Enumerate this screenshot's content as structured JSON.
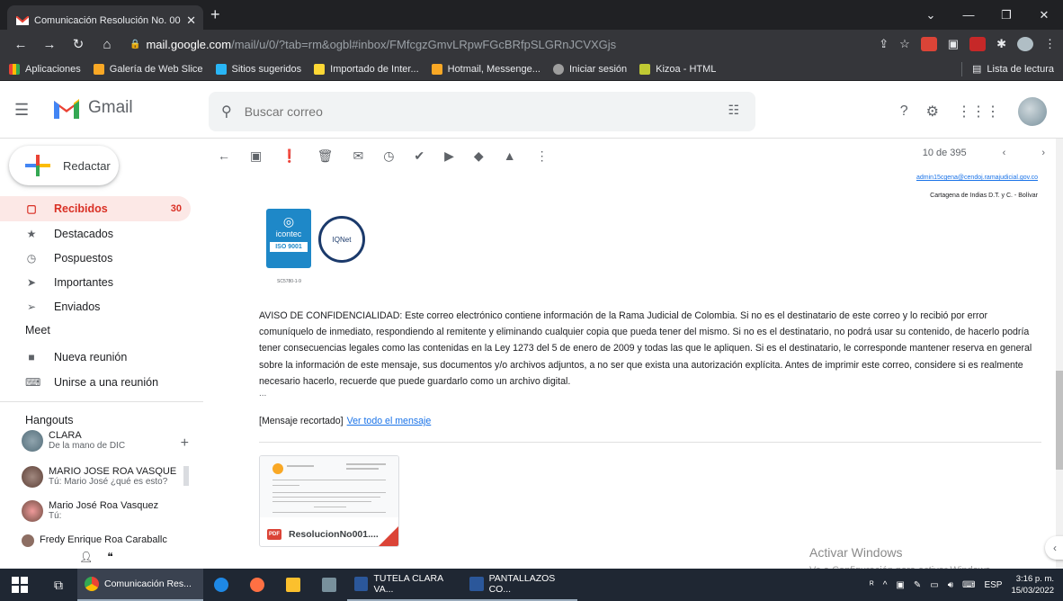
{
  "browser": {
    "tab_title": "Comunicación Resolución No. 00",
    "tab_close": "✕",
    "new_tab": "+",
    "url_host": "mail.google.com",
    "url_path": "/mail/u/0/?tab=rm&ogbl#inbox/FMfcgzGmvLRpwFGcBRfpSLGRnJCVXGjs",
    "bookmarks": [
      "Aplicaciones",
      "Galería de Web Slice",
      "Sitios sugeridos",
      "Importado de Inter...",
      "Hotmail, Messenge...",
      "Iniciar sesión",
      "Kizoa - HTML"
    ],
    "reading_list": "Lista de lectura"
  },
  "gmail": {
    "logo_text": "Gmail",
    "search_placeholder": "Buscar correo",
    "compose_label": "Redactar",
    "nav": [
      {
        "label": "Recibidos",
        "count": "30"
      },
      {
        "label": "Destacados"
      },
      {
        "label": "Pospuestos"
      },
      {
        "label": "Importantes"
      },
      {
        "label": "Enviados"
      }
    ],
    "meet_title": "Meet",
    "meet_items": [
      "Nueva reunión",
      "Unirse a una reunión"
    ],
    "hangouts_title": "Hangouts",
    "hangouts": [
      {
        "name": "CLARA",
        "sub": "De la mano de DIC"
      },
      {
        "name": "MARIO JOSE ROA VASQUE",
        "sub": "Tú: Mario José ¿qué es esto?"
      },
      {
        "name": "Mario José Roa Vasquez",
        "sub": "Tú:"
      },
      {
        "name": "Fredy Enrique Roa Caraballc",
        "sub": ""
      }
    ],
    "pager": "10 de 395"
  },
  "email": {
    "sig_email": "admin15cgena@cendoj.ramajudicial.gov.co",
    "sig_city": "Cartagena de Indias D.T. y C. - Bolívar",
    "icontec": "icontec",
    "iso": "ISO 9001",
    "iqnet": "IQNet",
    "cert_code": "SC5780-1-9",
    "notice": "AVISO DE CONFIDENCIALIDAD: Este correo electrónico contiene información de la Rama Judicial de Colombia. Si no es el destinatario de este correo y lo recibió por error comuníquelo de inmediato, respondiendo al remitente y eliminando cualquier copia que pueda tener del mismo. Si no es el destinatario, no podrá usar su contenido, de hacerlo podría tener consecuencias legales como las contenidas en la Ley 1273 del 5 de enero de 2009 y todas las que le apliquen. Si es el destinatario, le corresponde mantener reserva en general sobre la información de este mensaje, sus documentos y/o archivos adjuntos, a no ser que exista una autorización explícita. Antes de imprimir este correo, considere si es realmente necesario hacerlo, recuerde que puede guardarlo como un archivo digital.",
    "dots": "...",
    "trimmed": "[Mensaje recortado]",
    "view_all": "Ver todo el mensaje",
    "attachment_name": "ResolucionNo001....",
    "pdf_badge": "PDF"
  },
  "watermark": {
    "line1": "Activar Windows",
    "line2": "Ve a Configuración para activar Windows."
  },
  "taskbar": {
    "items": [
      "Comunicación Res...",
      "TUTELA CLARA VA...",
      "PANTALLAZOS CO..."
    ],
    "lang": "ESP",
    "time": "3:16 p. m.",
    "date": "15/03/2022"
  }
}
